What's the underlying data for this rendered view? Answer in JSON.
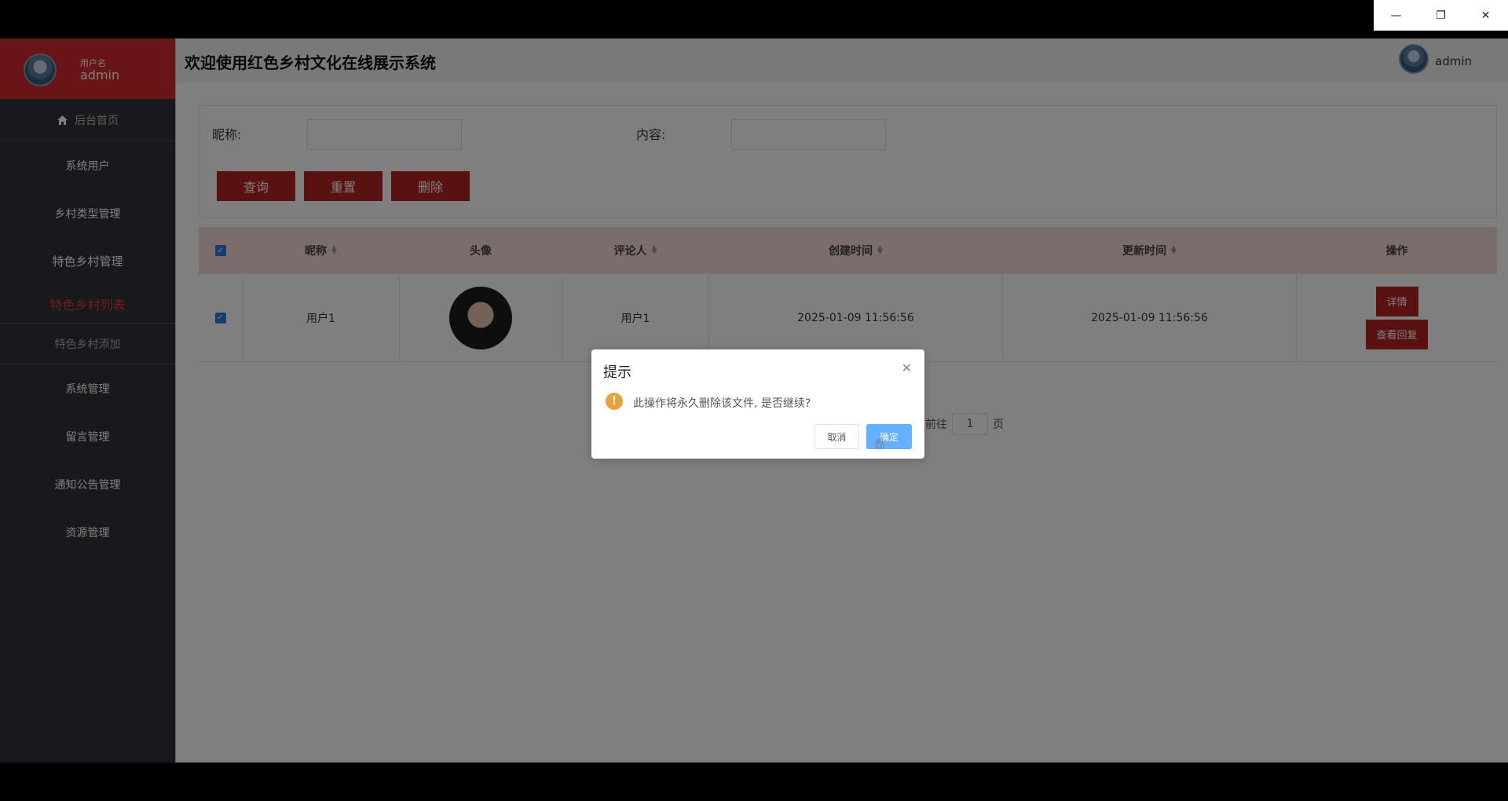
{
  "window": {
    "minimize": "—",
    "restore": "❐",
    "close": "✕"
  },
  "sidebar": {
    "user_label": "用户名",
    "username": "admin",
    "home": "后台首页",
    "items": [
      {
        "label": "系统用户"
      },
      {
        "label": "乡村类型管理"
      },
      {
        "label": "特色乡村管理"
      }
    ],
    "sub_active": "特色乡村列表",
    "sub_add": "特色乡村添加",
    "items2": [
      {
        "label": "系统管理"
      },
      {
        "label": "留言管理"
      },
      {
        "label": "通知公告管理"
      },
      {
        "label": "资源管理"
      }
    ]
  },
  "header": {
    "title": "欢迎使用红色乡村文化在线展示系统",
    "user": "admin"
  },
  "search": {
    "nickname_label": "昵称:",
    "content_label": "内容:",
    "query_btn": "查询",
    "reset_btn": "重置",
    "delete_btn": "删除"
  },
  "table": {
    "headers": [
      "昵称",
      "头像",
      "评论人",
      "创建时间",
      "更新时间",
      "操作"
    ],
    "rows": [
      {
        "nickname": "用户1",
        "commenter": "用户1",
        "created": "2025-01-09 11:56:56",
        "updated": "2025-01-09 11:56:56",
        "detail_btn": "详情",
        "reply_btn": "查看回复"
      }
    ]
  },
  "pager": {
    "goto": "前往",
    "page": "1",
    "suffix": "页"
  },
  "dialog": {
    "title": "提示",
    "message": "此操作将永久删除该文件, 是否继续?",
    "cancel": "取消",
    "ok": "确定"
  },
  "colors": {
    "brand_red": "#d22b2b",
    "button_red": "#b52222",
    "primary_blue": "#66b1ff",
    "warn": "#e6a23c"
  }
}
